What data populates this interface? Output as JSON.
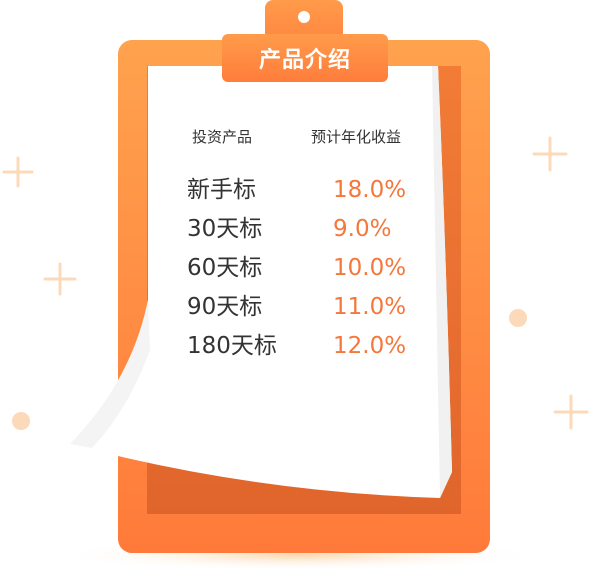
{
  "title": "产品介绍",
  "headers": {
    "product": "投资产品",
    "yield": "预计年化收益"
  },
  "products": [
    {
      "name": "新手标",
      "yield": "18.0%"
    },
    {
      "name": "30天标",
      "yield": "9.0%"
    },
    {
      "name": "60天标",
      "yield": "10.0%"
    },
    {
      "name": "90天标",
      "yield": "11.0%"
    },
    {
      "name": "180天标",
      "yield": "12.0%"
    }
  ],
  "colors": {
    "board_orange": "#FF8A3D",
    "board_dark": "#E86A2E",
    "yield_text": "#F4773B",
    "paper": "#FFFFFF",
    "accent_light": "#FCD9B8"
  }
}
